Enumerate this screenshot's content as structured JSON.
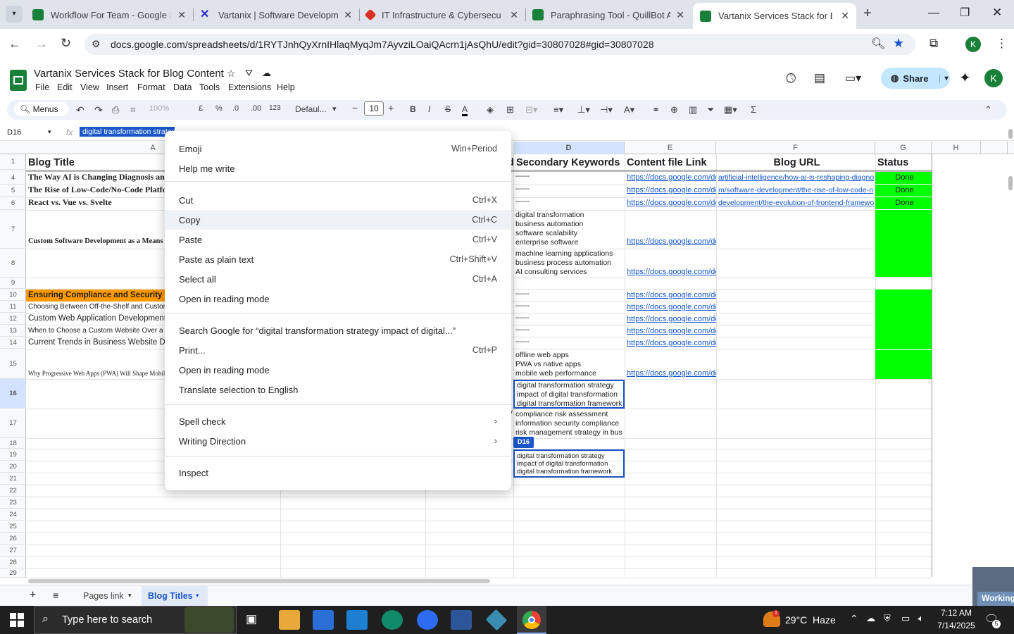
{
  "browser": {
    "tabs": [
      {
        "title": "Workflow For Team - Google Sh",
        "color": "#188038"
      },
      {
        "title": "Vartanix | Software Developme",
        "color": "#2b2bcf"
      },
      {
        "title": "IT Infrastructure & Cybersecurit",
        "color": "#d93025"
      },
      {
        "title": "Paraphrasing Tool - QuillBot AI",
        "color": "#188038"
      },
      {
        "title": "Vartanix Services Stack for Blog",
        "color": "#188038"
      }
    ],
    "url": "docs.google.com/spreadsheets/d/1RYTJnhQyXrnIHlaqMyqJm7AyvziLOaiQAcrn1jAsQhU/edit?gid=30807028#gid=30807028",
    "profile_initial": "K"
  },
  "doc": {
    "title": "Vartanix Services Stack for Blog Content",
    "menus": [
      "File",
      "Edit",
      "View",
      "Insert",
      "Format",
      "Data",
      "Tools",
      "Extensions",
      "Help"
    ],
    "share_label": "Share",
    "avatar": "K"
  },
  "toolbar": {
    "menus_label": "Menus",
    "zoom": "100%",
    "currency": "£",
    "percent": "%",
    "dec_minus": ".0",
    "dec_plus": ".00",
    "numfmt": "123",
    "font": "Defaul...",
    "font_size": "10"
  },
  "formula_bar": {
    "cell_ref": "D16",
    "fx": "fx",
    "value": "digital transformation strategy"
  },
  "grid": {
    "columns": [
      "A",
      "D",
      "E",
      "F",
      "G",
      "H"
    ],
    "headers": {
      "a": "Blog Title",
      "d": "Secondary Keywords",
      "d_prefix": "d",
      "e": "Content file Link",
      "f": "Blog URL",
      "g": "Status"
    },
    "row_numbers": [
      "1",
      "4",
      "5",
      "6",
      "7",
      "8",
      "9",
      "10",
      "11",
      "12",
      "13",
      "14",
      "15",
      "16",
      "17",
      "18",
      "19",
      "20",
      "21",
      "22",
      "23",
      "24",
      "25",
      "26",
      "27",
      "28",
      "29"
    ],
    "col_a": {
      "r4": "The Way AI is Changing Diagnosis and",
      "r5": "The Rise of Low-Code/No-Code Platfor",
      "r6": "React vs. Vue vs. Svelte",
      "r7": "Custom Software Development as a Means",
      "r10": "Ensuring Compliance and Security in C",
      "r11": "Choosing Between Off-the-Shelf and Custom",
      "r12": "Custom Web Application Development Pr",
      "r13": "When to Choose a Custom Website Over a W",
      "r14": "Current Trends in Business Website Desi",
      "r15": "Why Progressive Web Apps (PWA) Will Shape Mobile B"
    },
    "col_d": {
      "dashes": "------",
      "r7": "digital transformation\nbusiness automation\nsoftware scalability\nenterprise software",
      "r8": "machine learning applications\nbusiness process automation\nAI consulting services",
      "r15": "offline web apps\nPWA vs native apps\nmobile web performance",
      "r16": "digital transformation strategy\nimpact of digital transformation\ndigital transformation framework",
      "r17": "compliance risk assessment\ninformation security compliance\nrisk management strategy in bus",
      "tooltip": "D16",
      "paste_preview": "digital transformation strategy\nimpact of digital transformation\ndigital transformation framework"
    },
    "col_e_link": "https://docs.google.com/do",
    "col_f": {
      "r4": "artificial-intelligence/how-ai-is-reshaping-diagno",
      "r5": "m/software-development/the-rise-of-low-code-n",
      "r6": "development/the-evolution-of-frontend-framewo"
    },
    "status_done": "Done",
    "status_color": "#00ff00",
    "col_c_fragment": "y"
  },
  "context_menu": {
    "items": [
      {
        "label": "Emoji",
        "shortcut": "Win+Period"
      },
      {
        "label": "Help me write",
        "shortcut": ""
      },
      {
        "label": "Cut",
        "shortcut": "Ctrl+X"
      },
      {
        "label": "Copy",
        "shortcut": "Ctrl+C"
      },
      {
        "label": "Paste",
        "shortcut": "Ctrl+V"
      },
      {
        "label": "Paste as plain text",
        "shortcut": "Ctrl+Shift+V"
      },
      {
        "label": "Select all",
        "shortcut": "Ctrl+A"
      },
      {
        "label": "Open in reading mode",
        "shortcut": ""
      },
      {
        "label": "Search Google for “digital transformation strategy impact of digital...”",
        "shortcut": ""
      },
      {
        "label": "Print...",
        "shortcut": "Ctrl+P"
      },
      {
        "label": "Open in reading mode",
        "shortcut": ""
      },
      {
        "label": "Translate selection to English",
        "shortcut": ""
      },
      {
        "label": "Spell check",
        "shortcut": ""
      },
      {
        "label": "Writing Direction",
        "shortcut": ""
      },
      {
        "label": "Inspect",
        "shortcut": ""
      }
    ]
  },
  "sheets": {
    "tabs": [
      "Pages link",
      "Blog Titles"
    ],
    "working": "Working"
  },
  "taskbar": {
    "search_placeholder": "Type here to search",
    "weather": "29°C  Haze",
    "time": "7:12 AM",
    "date": "7/14/2025",
    "notif_count": "5",
    "weather_badge": "1"
  }
}
